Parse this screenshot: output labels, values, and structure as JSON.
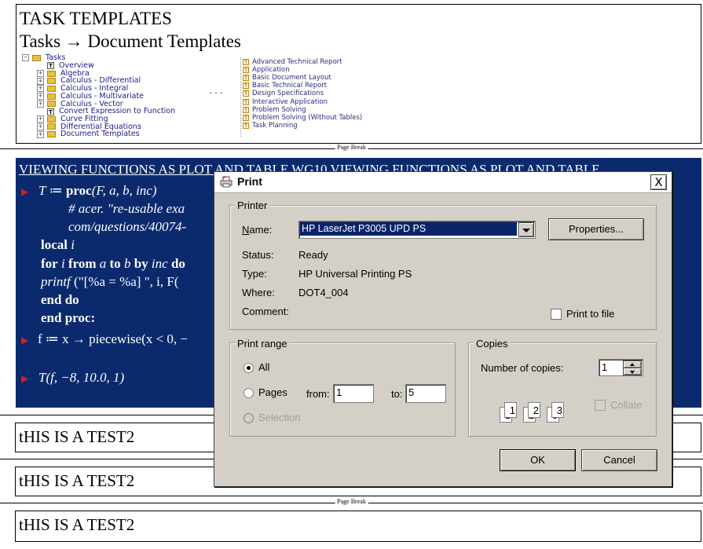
{
  "templates_section": {
    "heading": "TASK TEMPLATES",
    "subheading": "Tasks → Document Templates",
    "tree_root": "Tasks",
    "tree_items": [
      {
        "label": "Overview",
        "kind": "doc"
      },
      {
        "label": "Algebra",
        "kind": "folder"
      },
      {
        "label": "Calculus - Differential",
        "kind": "folder"
      },
      {
        "label": "Calculus - Integral",
        "kind": "folder"
      },
      {
        "label": "Calculus - Multivariate",
        "kind": "folder"
      },
      {
        "label": "Calculus - Vector",
        "kind": "folder"
      },
      {
        "label": "Convert Expression to Function",
        "kind": "doc"
      },
      {
        "label": "Curve Fitting",
        "kind": "folder"
      },
      {
        "label": "Differential Equations",
        "kind": "folder"
      },
      {
        "label": "Document Templates",
        "kind": "folder"
      }
    ],
    "ellipsis": "· · ·",
    "template_items": [
      "Advanced Technical Report",
      "Application",
      "Basic Document Layout",
      "Basic Technical Report",
      "Design Specifications",
      "Interactive Application",
      "Problem Solving",
      "Problem Solving (Without Tables)",
      "Task Planning"
    ]
  },
  "page_break_label": "Page Break",
  "code_section": {
    "title": "VIEWING FUNCTIONS AS PLOT AND TABLE WG10 VIEWING FUNCTIONS AS PLOT AND TABLE",
    "lines": {
      "l1_var": "T",
      "l1_assign": " ≔ ",
      "l1_kw": "proc",
      "l1_args": "(F, a, b, inc)",
      "l2": "# acer. \"re-usable exa",
      "l3": "com/questions/40074-",
      "l4_kw": "local",
      "l4_var": " i",
      "l5_for": "for",
      "l5_i": " i ",
      "l5_from": "from",
      "l5_a": " a ",
      "l5_to": "to",
      "l5_b": " b ",
      "l5_by": "by",
      "l5_inc": " inc ",
      "l5_do": "do",
      "l6_fn": "printf",
      "l6_rest": " (\"[%a = %a]  \", i, F(",
      "l7": "end do",
      "l8": "end proc:",
      "l9": "f ≔ x → piecewise(x < 0, −",
      "l10": "T(f, −8, 10.0, 1)"
    }
  },
  "test_lines": [
    "tHIS IS A TEST2",
    "tHIS IS A TEST2",
    "tHIS IS A TEST2"
  ],
  "print_dialog": {
    "title": "Print",
    "close_glyph": "X",
    "printer_group": "Printer",
    "name_label": "Name:",
    "name_value": "HP LaserJet P3005 UPD PS",
    "properties_button": "Properties...",
    "status_label": "Status:",
    "status_value": "Ready",
    "type_label": "Type:",
    "type_value": "HP Universal Printing PS",
    "where_label": "Where:",
    "where_value": "DOT4_004",
    "comment_label": "Comment:",
    "print_to_file": "Print to file",
    "range_group": "Print range",
    "range_all": "All",
    "range_pages": "Pages",
    "from_label": "from:",
    "from_value": "1",
    "to_label": "to:",
    "to_value": "5",
    "range_selection": "Selection",
    "copies_group": "Copies",
    "copies_label": "Number of copies:",
    "copies_value": "1",
    "collate": "Collate",
    "ok_button": "OK",
    "cancel_button": "Cancel"
  }
}
